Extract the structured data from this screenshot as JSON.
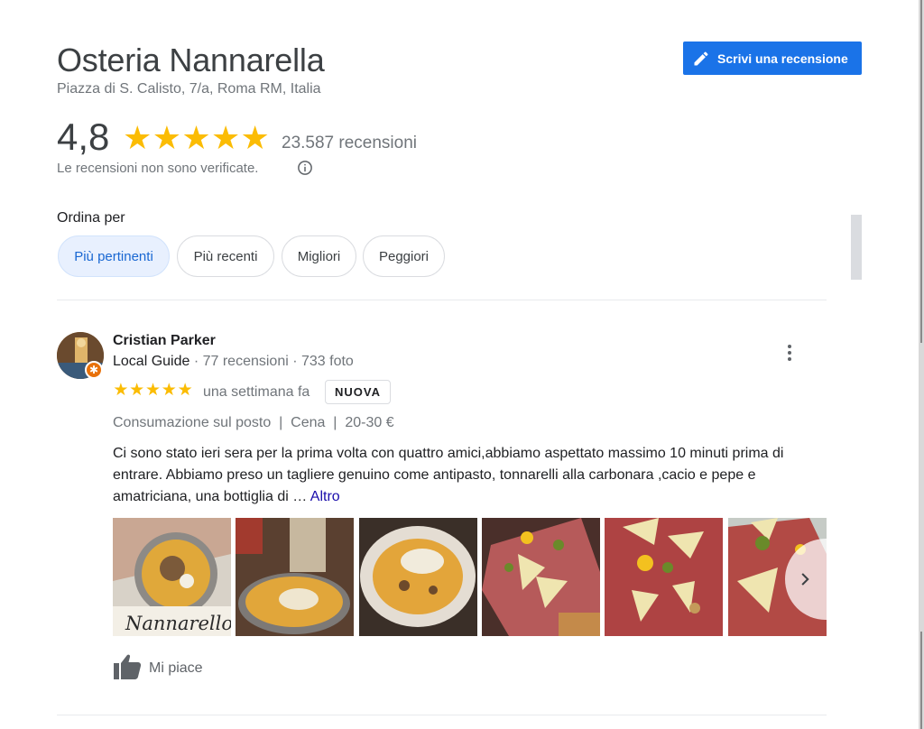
{
  "place": {
    "name": "Osteria Nannarella",
    "address": "Piazza di S. Calisto, 7/a, Roma RM, Italia",
    "write_review_label": "Scrivi una recensione"
  },
  "rating": {
    "value": "4,8",
    "stars": 5,
    "count_label": "23.587 recensioni",
    "unverified_note": "Le recensioni non sono verificate."
  },
  "sort": {
    "label": "Ordina per",
    "chips": [
      "Più pertinenti",
      "Più recenti",
      "Migliori",
      "Peggiori"
    ],
    "selected": "Più pertinenti"
  },
  "review": {
    "author": "Cristian Parker",
    "badge": "Local Guide",
    "stats": " · 77 recensioni · 733 foto",
    "stars": 5,
    "time": "una settimana fa",
    "new_label": "NUOVA",
    "attributes": "Consumazione sul posto  |  Cena  |  20-30 €",
    "text": "Ci sono stato ieri sera per la prima volta con quattro amici,abbiamo aspettato massimo 10 minuti prima di entrare. Abbiamo preso un tagliere genuino come antipasto, tonnarelli alla carbonara ,cacio e pepe e amatriciana, una bottiglia di … ",
    "more_label": "Altro",
    "like_label": "Mi piace",
    "photo_watermark": "Nannarello"
  },
  "colors": {
    "accent": "#1a73e8",
    "star": "#fbbc04",
    "chip_active_bg": "#e8f0fe",
    "link": "#1a0dab"
  },
  "icons": [
    "edit-pencil-icon",
    "info-icon",
    "more-vert-icon",
    "chevron-right-icon",
    "thumb-up-icon"
  ]
}
